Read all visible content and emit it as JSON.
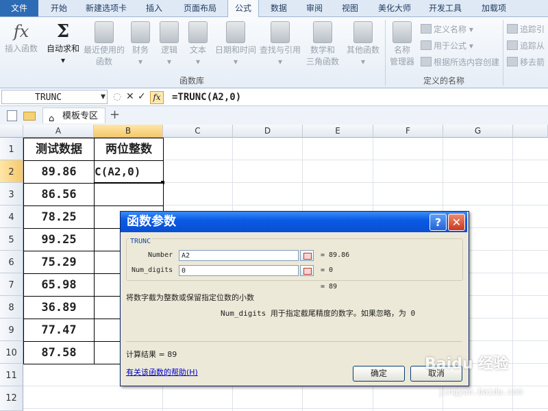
{
  "ribbon_tabs": [
    "文件",
    "开始",
    "新建选项卡",
    "插入",
    "页面布局",
    "公式",
    "数据",
    "审阅",
    "视图",
    "美化大师",
    "开发工具",
    "加载项"
  ],
  "ribbon": {
    "insert_function": "插入函数",
    "autosum": "自动求和",
    "recent": [
      "最近使用的",
      "函数"
    ],
    "financial": "财务",
    "logical": "逻辑",
    "text": "文本",
    "datetime": "日期和时间",
    "lookup": "查找与引用",
    "math": [
      "数学和",
      "三角函数"
    ],
    "more": "其他函数",
    "group_library": "函数库",
    "name_manager": [
      "名称",
      "管理器"
    ],
    "define_name": "定义名称",
    "use_in_formula": "用于公式",
    "create_from_selection": "根据所选内容创建",
    "group_names": "定义的名称",
    "trace_precedents": "追踪引",
    "trace_dependents": "追踪从",
    "remove_arrows": "移去箭"
  },
  "formula_bar": {
    "name_box": "TRUNC",
    "formula": "=TRUNC(A2,0)"
  },
  "workbook_tab": "模板专区",
  "columns": [
    "A",
    "B",
    "C",
    "D",
    "E",
    "F",
    "G"
  ],
  "rows": [
    "1",
    "2",
    "3",
    "4",
    "5",
    "6",
    "7",
    "8",
    "9",
    "10",
    "11",
    "12"
  ],
  "table": {
    "header_a": "测试数据",
    "header_b": "两位整数",
    "values": [
      "89.86",
      "86.56",
      "78.25",
      "99.25",
      "75.29",
      "65.98",
      "36.89",
      "77.47",
      "87.58"
    ],
    "b2_text": "C(A2,0)"
  },
  "dialog": {
    "title": "函数参数",
    "func_name": "TRUNC",
    "arg1_label": "Number",
    "arg1_value": "A2",
    "arg1_result": "= 89.86",
    "arg2_label": "Num_digits",
    "arg2_value": "0",
    "arg2_result": "= 0",
    "total_result": "= 89",
    "description": "将数字截为整数或保留指定位数的小数",
    "arg_desc": "Num_digits 用于指定截尾精度的数字。如果忽略，为 0",
    "calc_result": "计算结果 = 89",
    "help_link": "有关该函数的帮助(H)",
    "ok": "确定",
    "cancel": "取消",
    "help_btn": "?",
    "close_btn": "✕"
  },
  "watermark": {
    "logo": "Baidu 经验",
    "url": "jingyan.baidu.com"
  }
}
